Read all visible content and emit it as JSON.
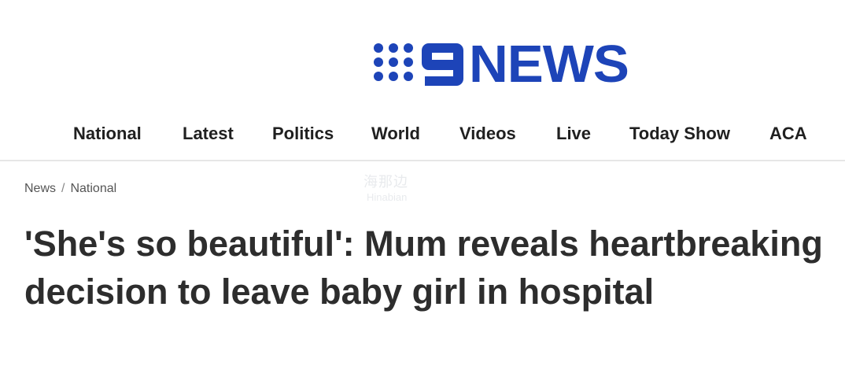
{
  "brand": {
    "logo_text": "NEWS",
    "logo_color": "#1d44b8"
  },
  "nav": {
    "items": [
      {
        "label": "National"
      },
      {
        "label": "Latest"
      },
      {
        "label": "Politics"
      },
      {
        "label": "World"
      },
      {
        "label": "Videos"
      },
      {
        "label": "Live"
      },
      {
        "label": "Today Show"
      },
      {
        "label": "ACA"
      }
    ]
  },
  "breadcrumb": {
    "items": [
      {
        "label": "News"
      },
      {
        "label": "National"
      }
    ],
    "separator": "/"
  },
  "watermark": {
    "chinese": "海那边",
    "latin": "Hinabian"
  },
  "article": {
    "headline": "'She's so beautiful': Mum reveals heartbreaking decision to leave baby girl in hospital"
  }
}
